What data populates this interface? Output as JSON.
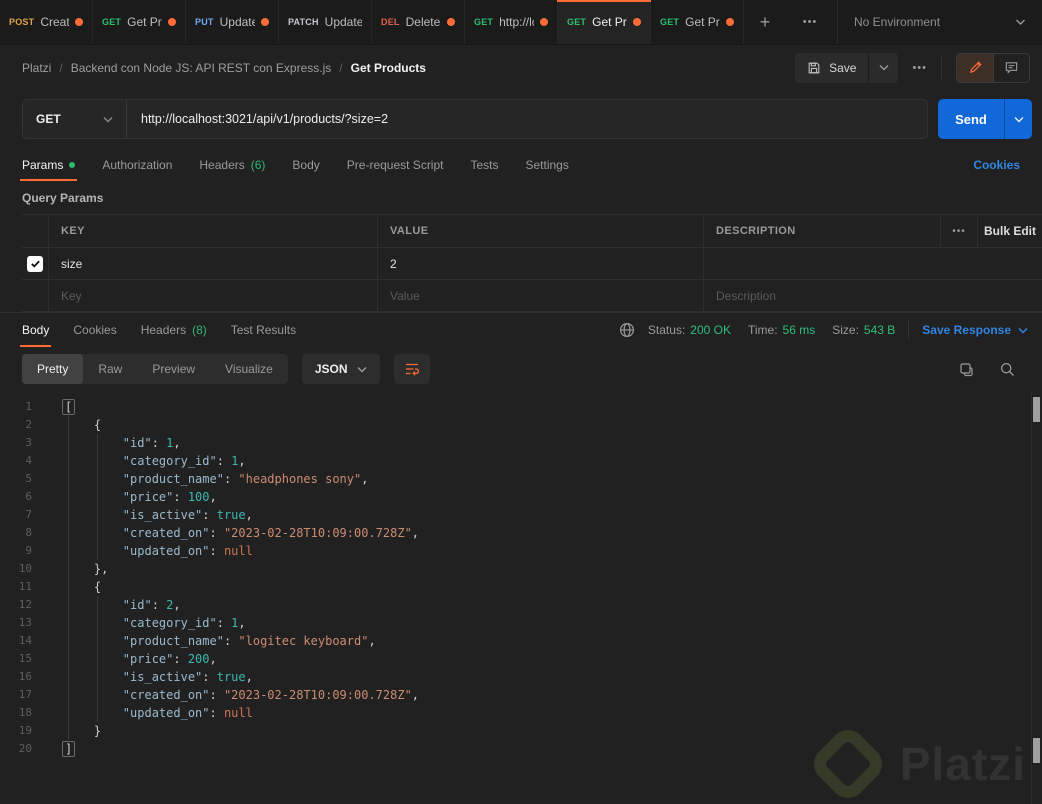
{
  "tabbar": {
    "tabs": [
      {
        "method": "POST",
        "label": "Create",
        "dirty": true,
        "active": false
      },
      {
        "method": "GET",
        "label": "Get Pro",
        "dirty": true,
        "active": false
      },
      {
        "method": "PUT",
        "label": "Update",
        "dirty": true,
        "active": false
      },
      {
        "method": "PATCH",
        "label": "Update",
        "dirty": false,
        "active": false
      },
      {
        "method": "DEL",
        "label": "Delete",
        "dirty": true,
        "active": false
      },
      {
        "method": "GET",
        "label": "http://lc",
        "dirty": true,
        "active": false
      },
      {
        "method": "GET",
        "label": "Get Pro",
        "dirty": true,
        "active": true
      },
      {
        "method": "GET",
        "label": "Get Pro",
        "dirty": true,
        "active": false
      }
    ],
    "add_glyph": "+",
    "more_glyph": "•••",
    "environment": "No Environment"
  },
  "method_colors": {
    "POST": "#dfa44a",
    "GET": "#2fbf71",
    "PUT": "#6fa8f5",
    "PATCH": "#c9c3d1",
    "DEL": "#e0604f"
  },
  "breadcrumb": {
    "parts": [
      "Platzi",
      "Backend con Node JS: API REST con Express.js",
      "Get Products"
    ],
    "separator": "/"
  },
  "header_actions": {
    "save_label": "Save",
    "more_glyph": "•••"
  },
  "request": {
    "method": "GET",
    "url": "http://localhost:3021/api/v1/products/?size=2",
    "send_label": "Send"
  },
  "request_tabs": {
    "items": [
      {
        "label": "Params",
        "active": true,
        "dot": true
      },
      {
        "label": "Authorization"
      },
      {
        "label": "Headers",
        "count": "(6)"
      },
      {
        "label": "Body"
      },
      {
        "label": "Pre-request Script"
      },
      {
        "label": "Tests"
      },
      {
        "label": "Settings"
      }
    ],
    "cookies_link": "Cookies"
  },
  "query_params": {
    "section_label": "Query Params",
    "columns": [
      "KEY",
      "VALUE",
      "DESCRIPTION"
    ],
    "more_glyph": "•••",
    "bulk_edit": "Bulk Edit",
    "rows": [
      {
        "checked": true,
        "key": "size",
        "value": "2",
        "description": ""
      }
    ],
    "placeholders": {
      "key": "Key",
      "value": "Value",
      "description": "Description"
    }
  },
  "response": {
    "tabs": [
      {
        "label": "Body",
        "active": true
      },
      {
        "label": "Cookies"
      },
      {
        "label": "Headers",
        "count": "(8)"
      },
      {
        "label": "Test Results"
      }
    ],
    "status_label": "Status:",
    "status_value": "200 OK",
    "time_label": "Time:",
    "time_value": "56 ms",
    "size_label": "Size:",
    "size_value": "543 B",
    "save_response": "Save Response"
  },
  "response_toolbar": {
    "views": [
      {
        "label": "Pretty",
        "active": true
      },
      {
        "label": "Raw"
      },
      {
        "label": "Preview"
      },
      {
        "label": "Visualize"
      }
    ],
    "format": "JSON"
  },
  "code": {
    "lines": [
      [
        [
          "fb",
          "["
        ]
      ],
      [
        [
          "p",
          "    {"
        ]
      ],
      [
        [
          "k",
          "        \"id\""
        ],
        [
          "p",
          ": "
        ],
        [
          "n",
          "1"
        ],
        [
          "p",
          ","
        ]
      ],
      [
        [
          "k",
          "        \"category_id\""
        ],
        [
          "p",
          ": "
        ],
        [
          "n",
          "1"
        ],
        [
          "p",
          ","
        ]
      ],
      [
        [
          "k",
          "        \"product_name\""
        ],
        [
          "p",
          ": "
        ],
        [
          "s",
          "\"headphones sony\""
        ],
        [
          "p",
          ","
        ]
      ],
      [
        [
          "k",
          "        \"price\""
        ],
        [
          "p",
          ": "
        ],
        [
          "n",
          "100"
        ],
        [
          "p",
          ","
        ]
      ],
      [
        [
          "k",
          "        \"is_active\""
        ],
        [
          "p",
          ": "
        ],
        [
          "b",
          "true"
        ],
        [
          "p",
          ","
        ]
      ],
      [
        [
          "k",
          "        \"created_on\""
        ],
        [
          "p",
          ": "
        ],
        [
          "s",
          "\"2023-02-28T10:09:00.728Z\""
        ],
        [
          "p",
          ","
        ]
      ],
      [
        [
          "k",
          "        \"updated_on\""
        ],
        [
          "p",
          ": "
        ],
        [
          "x",
          "null"
        ]
      ],
      [
        [
          "p",
          "    },"
        ]
      ],
      [
        [
          "p",
          "    {"
        ]
      ],
      [
        [
          "k",
          "        \"id\""
        ],
        [
          "p",
          ": "
        ],
        [
          "n",
          "2"
        ],
        [
          "p",
          ","
        ]
      ],
      [
        [
          "k",
          "        \"category_id\""
        ],
        [
          "p",
          ": "
        ],
        [
          "n",
          "1"
        ],
        [
          "p",
          ","
        ]
      ],
      [
        [
          "k",
          "        \"product_name\""
        ],
        [
          "p",
          ": "
        ],
        [
          "s",
          "\"logitec keyboard\""
        ],
        [
          "p",
          ","
        ]
      ],
      [
        [
          "k",
          "        \"price\""
        ],
        [
          "p",
          ": "
        ],
        [
          "n",
          "200"
        ],
        [
          "p",
          ","
        ]
      ],
      [
        [
          "k",
          "        \"is_active\""
        ],
        [
          "p",
          ": "
        ],
        [
          "b",
          "true"
        ],
        [
          "p",
          ","
        ]
      ],
      [
        [
          "k",
          "        \"created_on\""
        ],
        [
          "p",
          ": "
        ],
        [
          "s",
          "\"2023-02-28T10:09:00.728Z\""
        ],
        [
          "p",
          ","
        ]
      ],
      [
        [
          "k",
          "        \"updated_on\""
        ],
        [
          "p",
          ": "
        ],
        [
          "x",
          "null"
        ]
      ],
      [
        [
          "p",
          "    }"
        ]
      ],
      [
        [
          "fb",
          "]"
        ]
      ]
    ]
  },
  "watermark": {
    "brand": "Platzi"
  },
  "colors": {
    "accent_orange": "#ff6c37",
    "green": "#2ebe7b",
    "link_blue": "#3186e2",
    "send_blue": "#1168d8"
  }
}
